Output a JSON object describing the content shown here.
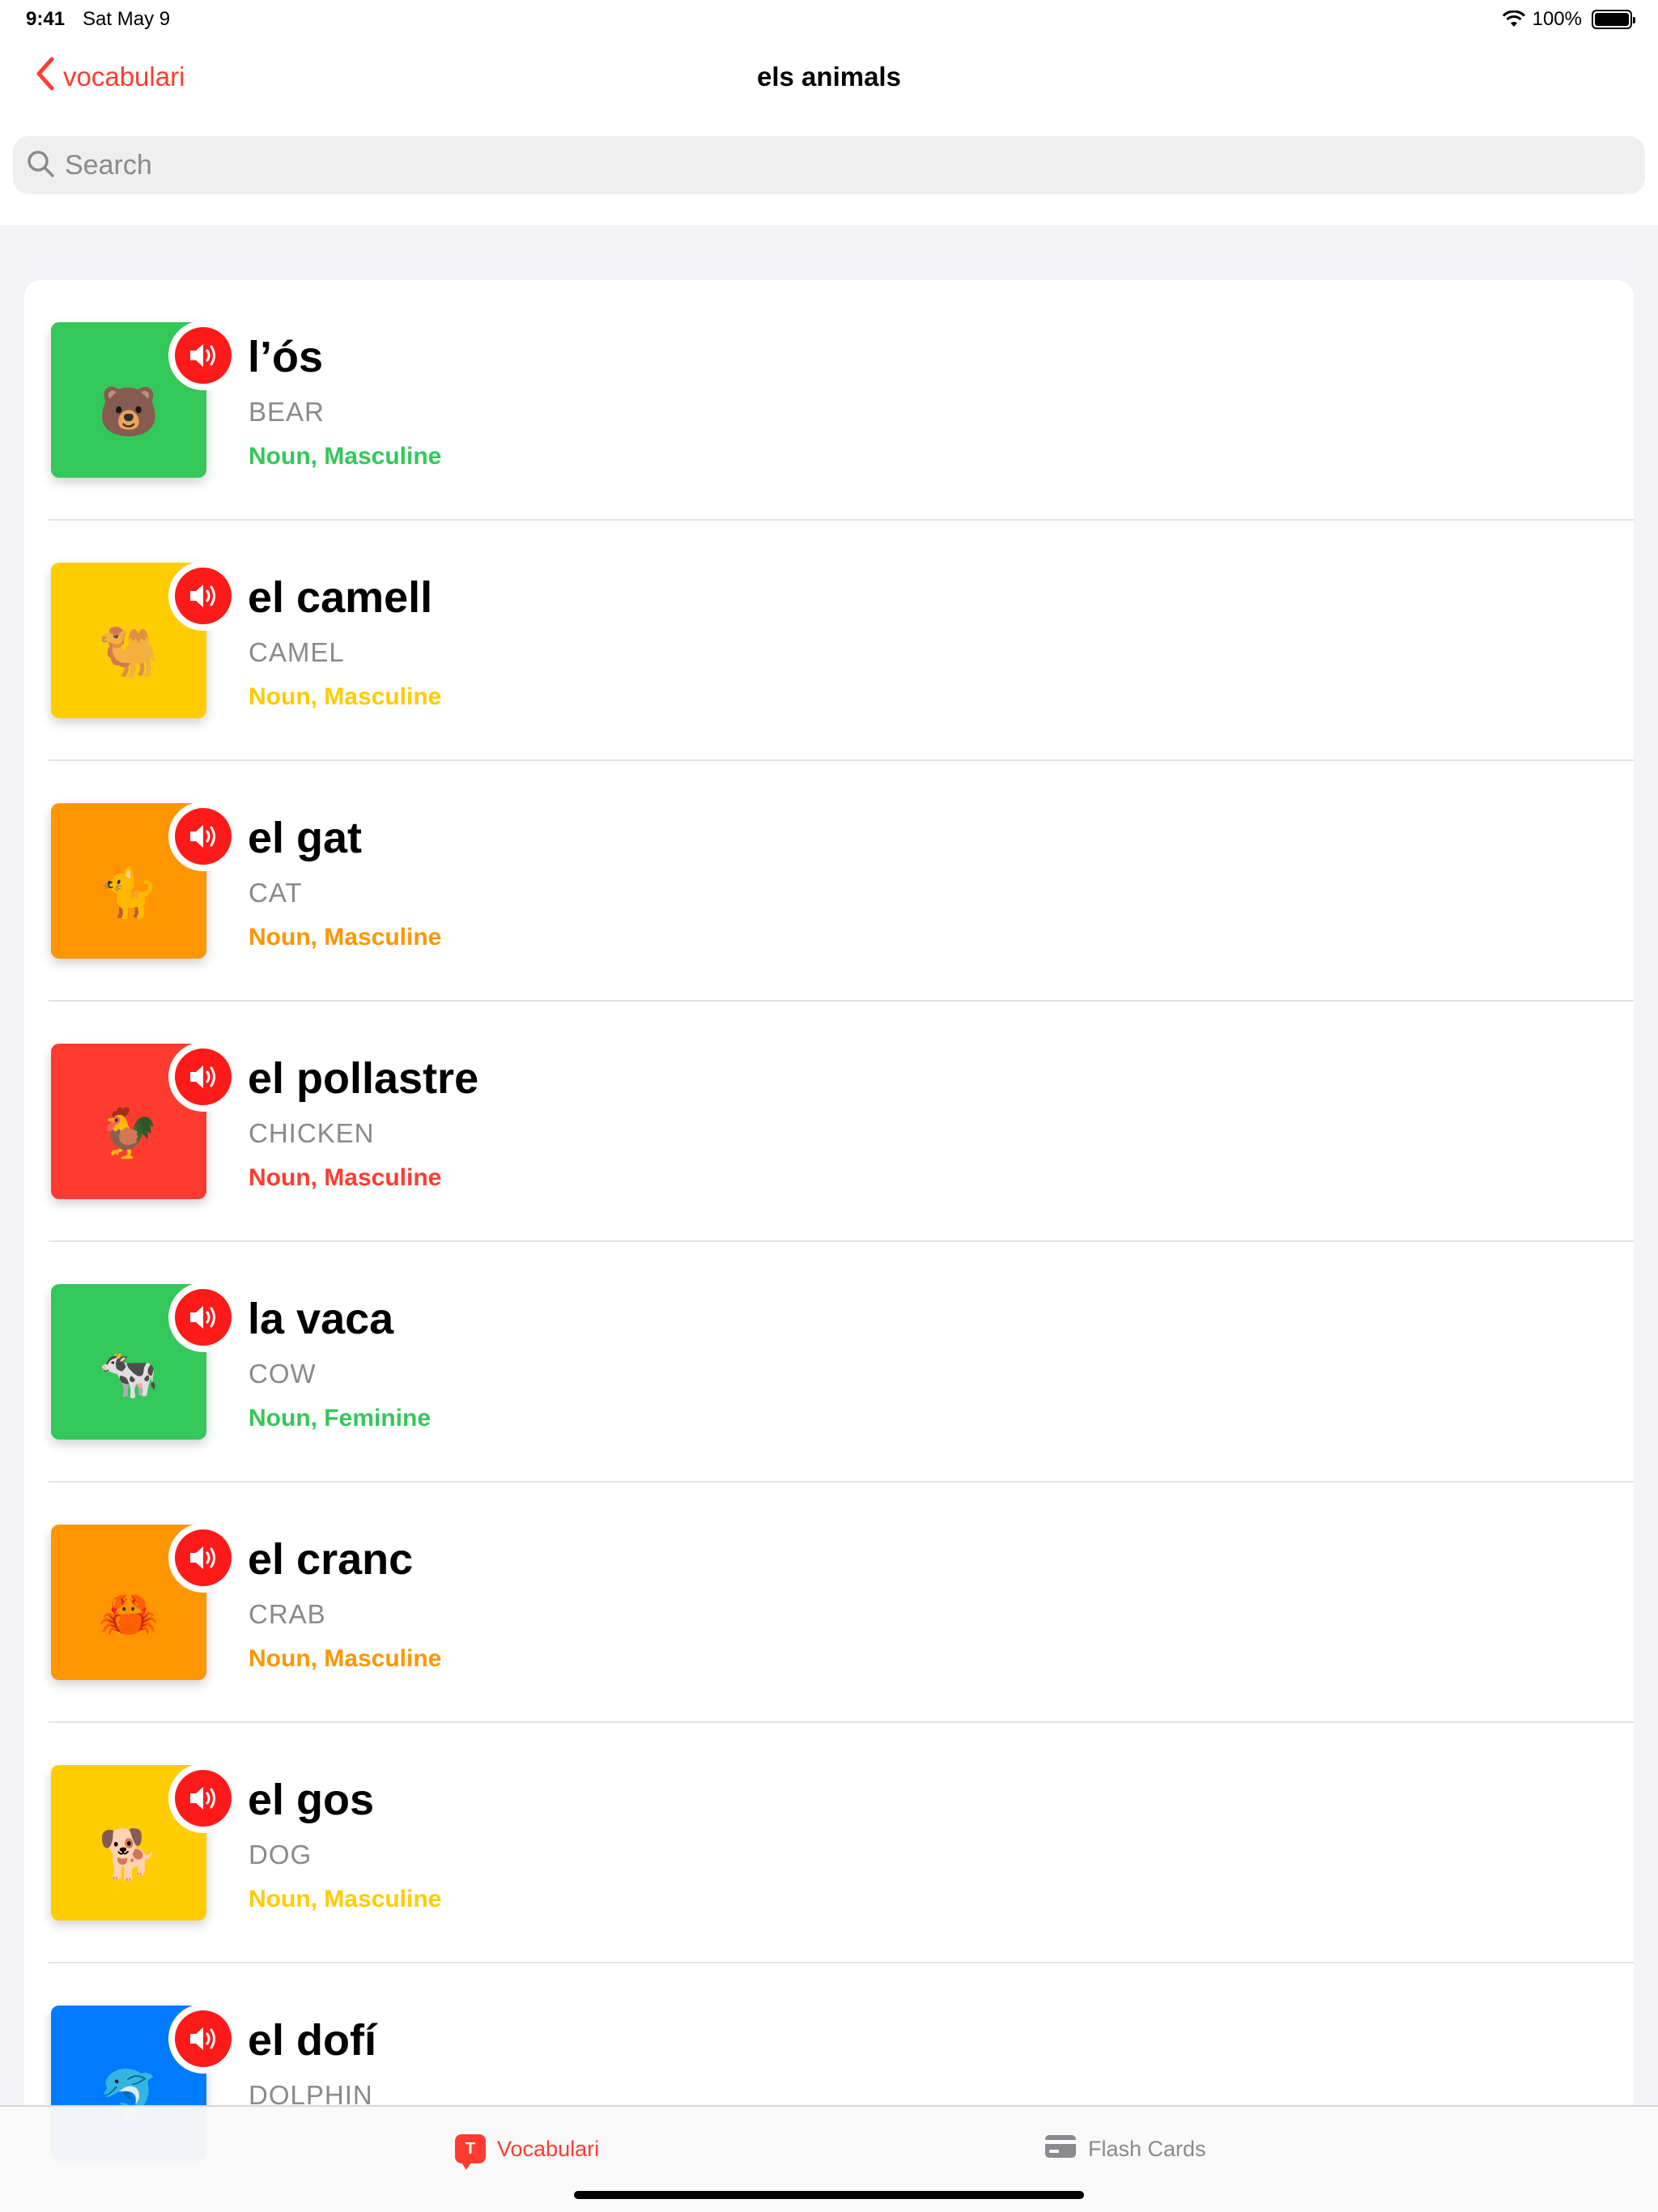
{
  "status_bar": {
    "time": "9:41",
    "date": "Sat May 9",
    "battery_text": "100%",
    "battery_level": 1.0
  },
  "nav": {
    "back_label": "vocabulari",
    "title": "els animals",
    "back_icon": "chevron-left-icon"
  },
  "search": {
    "placeholder": "Search",
    "value": "",
    "icon": "magnifier-icon"
  },
  "colors": {
    "accent": "#ff3b30",
    "speaker": "#ff1a1a",
    "green": "#34c759",
    "yellow": "#ffcc00",
    "orange": "#ff9500",
    "red": "#ff3b30",
    "blue": "#007aff"
  },
  "items": [
    {
      "word": "l’ós",
      "translation": "BEAR",
      "grammar": "Noun, Masculine",
      "color": "#34c759",
      "emoji": "🐻"
    },
    {
      "word": "el camell",
      "translation": "CAMEL",
      "grammar": "Noun, Masculine",
      "color": "#ffcc00",
      "emoji": "🐫"
    },
    {
      "word": "el gat",
      "translation": "CAT",
      "grammar": "Noun, Masculine",
      "color": "#ff9500",
      "emoji": "🐈"
    },
    {
      "word": "el pollastre",
      "translation": "CHICKEN",
      "grammar": "Noun, Masculine",
      "color": "#ff3b30",
      "emoji": "🐓"
    },
    {
      "word": "la vaca",
      "translation": "COW",
      "grammar": "Noun, Feminine",
      "color": "#34c759",
      "emoji": "🐄"
    },
    {
      "word": "el cranc",
      "translation": "CRAB",
      "grammar": "Noun, Masculine",
      "color": "#ff9500",
      "emoji": "🦀"
    },
    {
      "word": "el gos",
      "translation": "DOG",
      "grammar": "Noun, Masculine",
      "color": "#ffcc00",
      "emoji": "🐕"
    },
    {
      "word": "el dofí",
      "translation": "DOLPHIN",
      "grammar": "",
      "color": "#007aff",
      "emoji": "🐬"
    }
  ],
  "tabs": [
    {
      "label": "Vocabulari",
      "icon": "vocabulari-icon",
      "selected": true
    },
    {
      "label": "Flash Cards",
      "icon": "credit-card-icon",
      "selected": false
    }
  ]
}
